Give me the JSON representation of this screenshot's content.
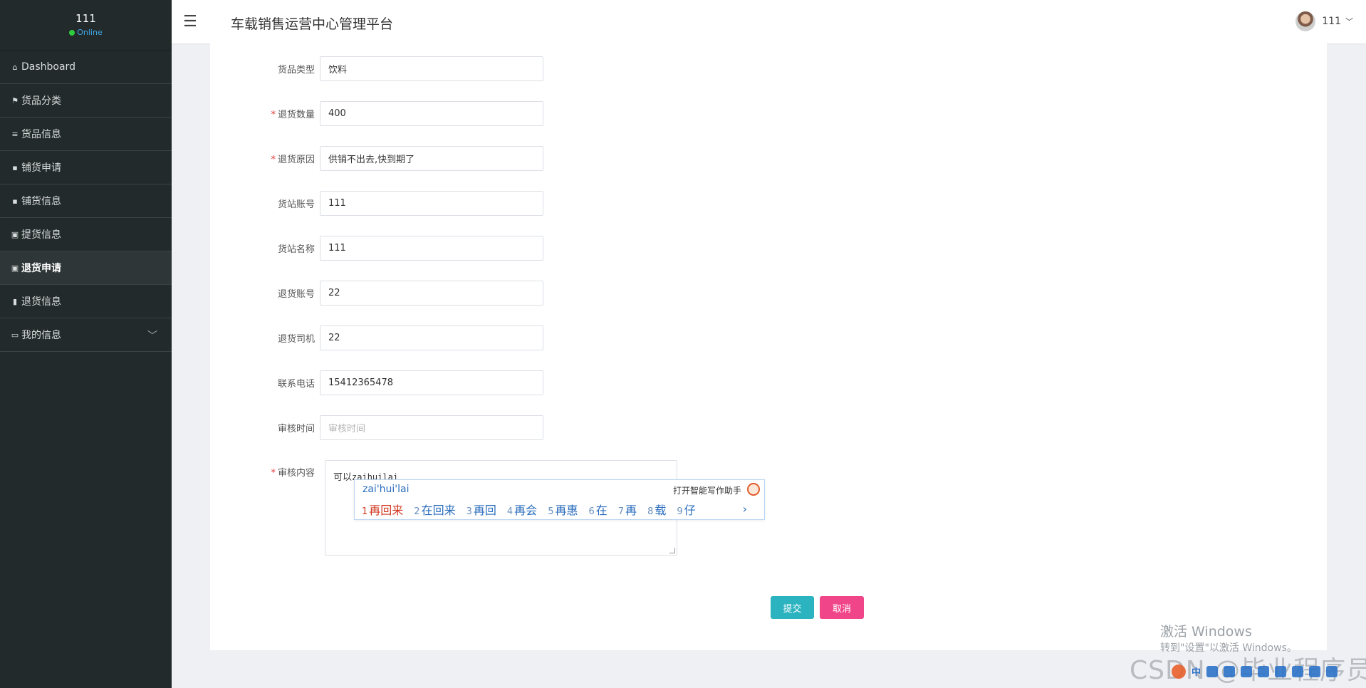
{
  "sidebar": {
    "user_name": "111",
    "status": "Online",
    "items": [
      {
        "label": "Dashboard",
        "icon": "home-icon"
      },
      {
        "label": "货品分类",
        "icon": "flag-icon"
      },
      {
        "label": "货品信息",
        "icon": "list-icon"
      },
      {
        "label": "铺货申请",
        "icon": "grid-icon"
      },
      {
        "label": "铺货信息",
        "icon": "grid-icon"
      },
      {
        "label": "提货信息",
        "icon": "clipboard-icon"
      },
      {
        "label": "退货申请",
        "icon": "clipboard-icon",
        "active": true
      },
      {
        "label": "退货信息",
        "icon": "bar-chart-icon"
      },
      {
        "label": "我的信息",
        "icon": "card-icon",
        "has_submenu": true
      }
    ]
  },
  "header": {
    "title": "车载销售运营中心管理平台",
    "user": "111",
    "menu_icon": "☰"
  },
  "form": {
    "fields": [
      {
        "label": "货品类型",
        "value": "饮料",
        "required": false
      },
      {
        "label": "退货数量",
        "value": "400",
        "required": true
      },
      {
        "label": "退货原因",
        "value": "供销不出去,快到期了",
        "required": true
      },
      {
        "label": "货站账号",
        "value": "111",
        "required": false
      },
      {
        "label": "货站名称",
        "value": "111",
        "required": false
      },
      {
        "label": "退货账号",
        "value": "22",
        "required": false
      },
      {
        "label": "退货司机",
        "value": "22",
        "required": false
      },
      {
        "label": "联系电话",
        "value": "15412365478",
        "required": false
      },
      {
        "label": "审核时间",
        "placeholder": "审核时间",
        "required": false
      }
    ],
    "review": {
      "label": "审核内容",
      "required": true,
      "text_prefix": "可以",
      "text_composing": "zaihuilai"
    },
    "submit_label": "提交",
    "cancel_label": "取消",
    "required_mark": "*"
  },
  "ime": {
    "composition": "zai'hui'lai",
    "assistant_label": "打开智能写作助手",
    "candidates": [
      {
        "n": "1",
        "text": "再回来"
      },
      {
        "n": "2",
        "text": "在回来"
      },
      {
        "n": "3",
        "text": "再回"
      },
      {
        "n": "4",
        "text": "再会"
      },
      {
        "n": "5",
        "text": "再惠"
      },
      {
        "n": "6",
        "text": "在"
      },
      {
        "n": "7",
        "text": "再"
      },
      {
        "n": "8",
        "text": "载"
      },
      {
        "n": "9",
        "text": "仔"
      }
    ],
    "more": "›"
  },
  "watermark": {
    "activate_title": "激活 Windows",
    "activate_sub": "转到\"设置\"以激活 Windows。",
    "csdn": "CSDN @毕业程序员",
    "ime_mode": "中"
  },
  "colors": {
    "sidebar_bg": "#232a2b",
    "submit": "#2bb3c0",
    "cancel": "#f1458a",
    "required": "#e53935"
  }
}
